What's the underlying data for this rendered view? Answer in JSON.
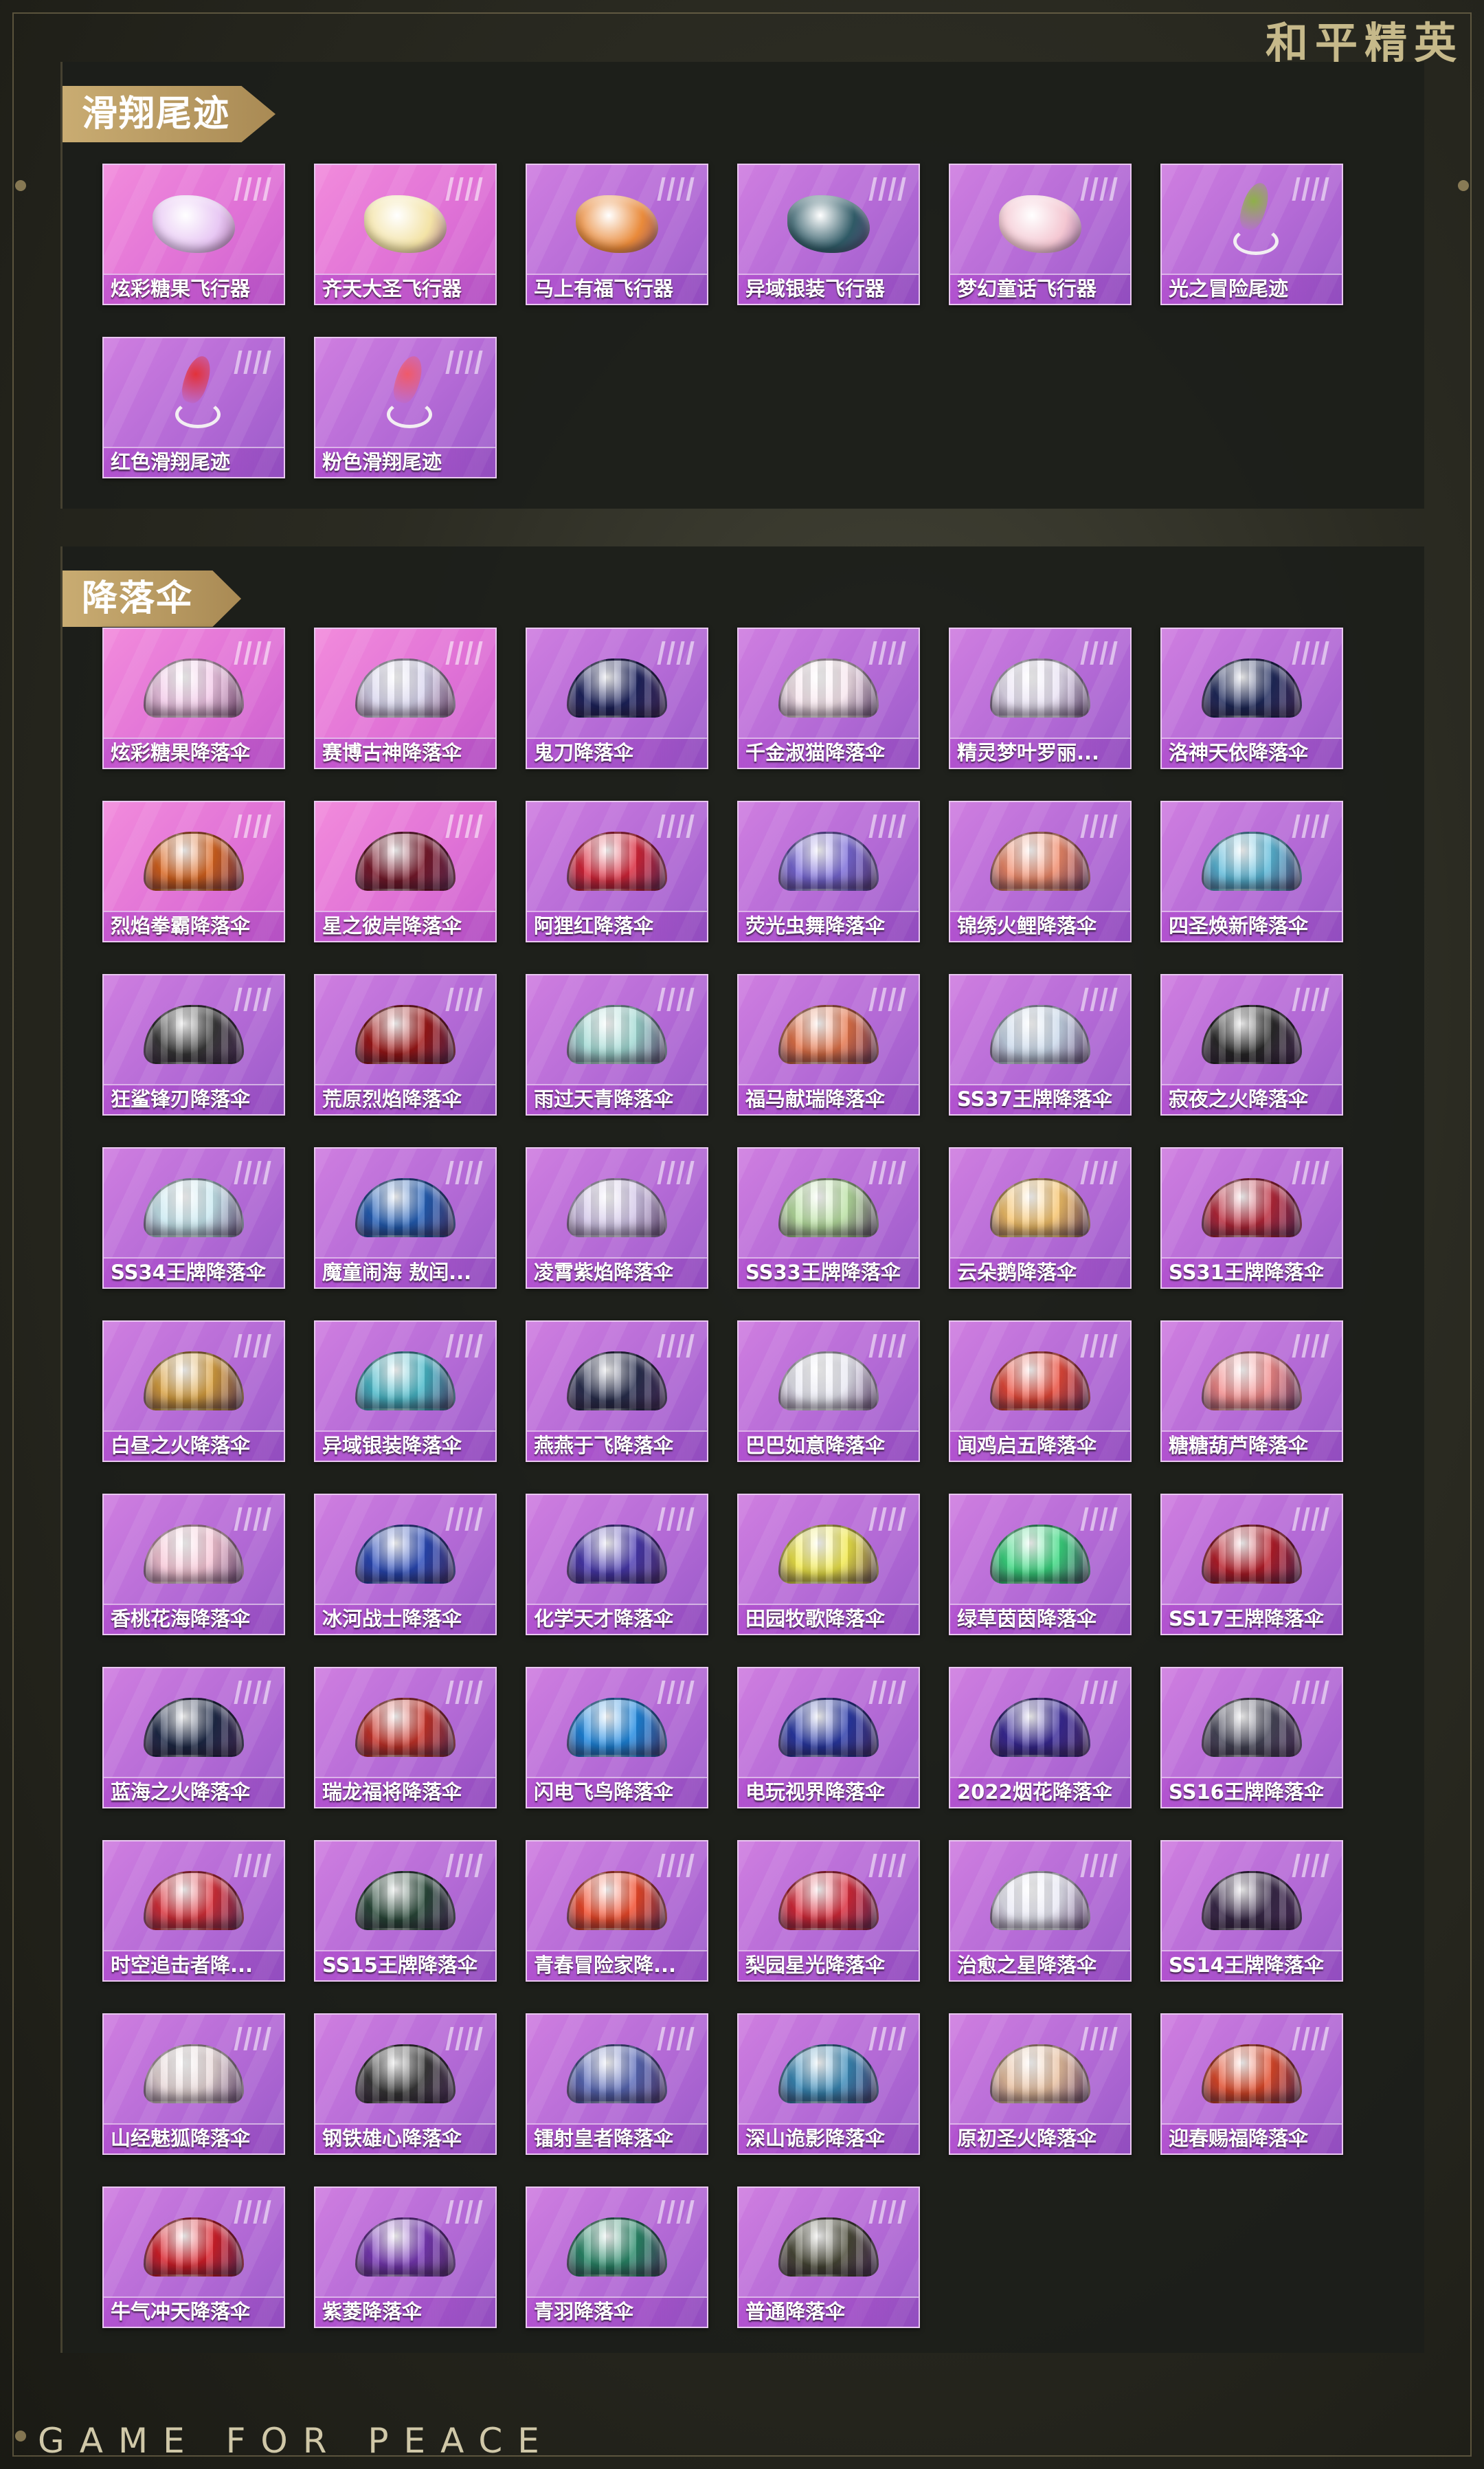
{
  "brand": "和平精英",
  "footer": "GAME FOR PEACE",
  "colors": {
    "accent_gold": "#c9ac72",
    "card_pink": "#e072d6",
    "card_purple": "#b46ad6"
  },
  "sections": [
    {
      "title": "滑翔尾迹",
      "items": [
        {
          "label": "炫彩糖果飞行器",
          "kind": "glider",
          "bg": "pink",
          "color": "#e8c8f4"
        },
        {
          "label": "齐天大圣飞行器",
          "kind": "glider",
          "bg": "pink",
          "color": "#f3e3a6"
        },
        {
          "label": "马上有福飞行器",
          "kind": "glider",
          "bg": "purple",
          "color": "#e98a3a"
        },
        {
          "label": "异域银装飞行器",
          "kind": "glider",
          "bg": "purple",
          "color": "#2f5a66"
        },
        {
          "label": "梦幻童话飞行器",
          "kind": "glider",
          "bg": "purple",
          "color": "#f4c7d2"
        },
        {
          "label": "光之冒险尾迹",
          "kind": "trail",
          "bg": "purple",
          "color": "#8fb04a"
        },
        {
          "label": "红色滑翔尾迹",
          "kind": "trail",
          "bg": "purple",
          "color": "#e2323a"
        },
        {
          "label": "粉色滑翔尾迹",
          "kind": "trail",
          "bg": "purple",
          "color": "#ef5a6a"
        }
      ]
    },
    {
      "title": "降落伞",
      "items": [
        {
          "label": "炫彩糖果降落伞",
          "bg": "pink",
          "color": "#f2c9e8"
        },
        {
          "label": "赛博古神降落伞",
          "bg": "pink",
          "color": "#d9d6ee"
        },
        {
          "label": "鬼刀降落伞",
          "bg": "purple",
          "color": "#1e2460"
        },
        {
          "label": "千金淑猫降落伞",
          "bg": "purple",
          "color": "#f8e6ee"
        },
        {
          "label": "精灵梦叶罗丽...",
          "bg": "purple",
          "color": "#e9e2f4"
        },
        {
          "label": "洛神天依降落伞",
          "bg": "purple",
          "color": "#1f2a5c"
        },
        {
          "label": "烈焰拳霸降落伞",
          "bg": "pink",
          "color": "#d8641e"
        },
        {
          "label": "星之彼岸降落伞",
          "bg": "pink",
          "color": "#7a1a2c"
        },
        {
          "label": "阿狸红降落伞",
          "bg": "purple",
          "color": "#d8263a"
        },
        {
          "label": "荧光虫舞降落伞",
          "bg": "purple",
          "color": "#7a6ad8"
        },
        {
          "label": "锦绣火鲤降落伞",
          "bg": "purple",
          "color": "#ef8a6a"
        },
        {
          "label": "四圣焕新降落伞",
          "bg": "purple",
          "color": "#5ab8d8"
        },
        {
          "label": "狂鲨锋刃降落伞",
          "bg": "purple",
          "color": "#3a3a3a"
        },
        {
          "label": "荒原烈焰降落伞",
          "bg": "purple",
          "color": "#a01818"
        },
        {
          "label": "雨过天青降落伞",
          "bg": "purple",
          "color": "#9fd8d2"
        },
        {
          "label": "福马献瑞降落伞",
          "bg": "purple",
          "color": "#e4744a"
        },
        {
          "label": "SS37王牌降落伞",
          "bg": "purple",
          "color": "#c9d8ea"
        },
        {
          "label": "寂夜之火降落伞",
          "bg": "purple",
          "color": "#2a2a2a"
        },
        {
          "label": "SS34王牌降落伞",
          "bg": "purple",
          "color": "#c8e8f0"
        },
        {
          "label": "魔童闹海 敖闰...",
          "bg": "purple",
          "color": "#2460b8"
        },
        {
          "label": "凌霄紫焰降落伞",
          "bg": "purple",
          "color": "#d2c6e8"
        },
        {
          "label": "SS33王牌降落伞",
          "bg": "purple",
          "color": "#b8e0a0"
        },
        {
          "label": "云朵鹅降落伞",
          "bg": "purple",
          "color": "#f5c26a"
        },
        {
          "label": "SS31王牌降落伞",
          "bg": "purple",
          "color": "#b8283a"
        },
        {
          "label": "白昼之火降落伞",
          "bg": "purple",
          "color": "#d8a040"
        },
        {
          "label": "异域银装降落伞",
          "bg": "purple",
          "color": "#48b8c8"
        },
        {
          "label": "燕燕于飞降落伞",
          "bg": "purple",
          "color": "#2a3050"
        },
        {
          "label": "巴巴如意降落伞",
          "bg": "purple",
          "color": "#e8e8f2"
        },
        {
          "label": "闻鸡启五降落伞",
          "bg": "purple",
          "color": "#e84a3a"
        },
        {
          "label": "糖糖葫芦降落伞",
          "bg": "purple",
          "color": "#f08888"
        },
        {
          "label": "香桃花海降落伞",
          "bg": "purple",
          "color": "#f7c6d6"
        },
        {
          "label": "冰河战士降落伞",
          "bg": "purple",
          "color": "#2a4ab8"
        },
        {
          "label": "化学天才降落伞",
          "bg": "purple",
          "color": "#4a3ab0"
        },
        {
          "label": "田园牧歌降落伞",
          "bg": "purple",
          "color": "#f0e84a"
        },
        {
          "label": "绿草茵茵降落伞",
          "bg": "purple",
          "color": "#3ad880"
        },
        {
          "label": "SS17王牌降落伞",
          "bg": "purple",
          "color": "#b81e2a"
        },
        {
          "label": "蓝海之火降落伞",
          "bg": "purple",
          "color": "#1e2a48"
        },
        {
          "label": "瑞龙福将降落伞",
          "bg": "purple",
          "color": "#c8342a"
        },
        {
          "label": "闪电飞鸟降落伞",
          "bg": "purple",
          "color": "#1e88e0"
        },
        {
          "label": "电玩视界降落伞",
          "bg": "purple",
          "color": "#2a3aa8"
        },
        {
          "label": "2022烟花降落伞",
          "bg": "purple",
          "color": "#3a2a98"
        },
        {
          "label": "SS16王牌降落伞",
          "bg": "purple",
          "color": "#48485a"
        },
        {
          "label": "时空追击者降...",
          "bg": "purple",
          "color": "#d8303a"
        },
        {
          "label": "SS15王牌降落伞",
          "bg": "purple",
          "color": "#2a4a3a"
        },
        {
          "label": "青春冒险家降...",
          "bg": "purple",
          "color": "#f04a2a"
        },
        {
          "label": "梨园星光降落伞",
          "bg": "purple",
          "color": "#d82a3a"
        },
        {
          "label": "治愈之星降落伞",
          "bg": "purple",
          "color": "#e8e8f4"
        },
        {
          "label": "SS14王牌降落伞",
          "bg": "purple",
          "color": "#3a2a4a"
        },
        {
          "label": "山经魅狐降落伞",
          "bg": "purple",
          "color": "#e8d8d8"
        },
        {
          "label": "钢铁雄心降落伞",
          "bg": "purple",
          "color": "#3a3a3a"
        },
        {
          "label": "镭射皇者降落伞",
          "bg": "purple",
          "color": "#5a6ab8"
        },
        {
          "label": "深山诡影降落伞",
          "bg": "purple",
          "color": "#3a8ab8"
        },
        {
          "label": "原初圣火降落伞",
          "bg": "purple",
          "color": "#e8c0a0"
        },
        {
          "label": "迎春赐福降落伞",
          "bg": "purple",
          "color": "#e04a2a"
        },
        {
          "label": "牛气冲天降落伞",
          "bg": "purple",
          "color": "#d8202a"
        },
        {
          "label": "紫菱降落伞",
          "bg": "purple",
          "color": "#7a3ab8"
        },
        {
          "label": "青羽降落伞",
          "bg": "purple",
          "color": "#2a8a6a"
        },
        {
          "label": "普通降落伞",
          "bg": "purple",
          "color": "#4a4a38"
        }
      ]
    }
  ]
}
